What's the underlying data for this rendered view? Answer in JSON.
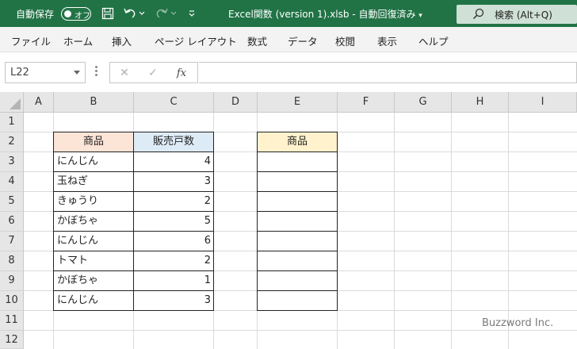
{
  "titlebar": {
    "autosave_label": "自動保存",
    "toggle_state": "オフ",
    "filename": "Excel関数 (version 1).xlsb  -  自動回復済み",
    "search_placeholder": "検索 (Alt+Q)",
    "background": "#217346"
  },
  "ribbon": {
    "tabs": [
      "ファイル",
      "ホーム",
      "挿入",
      "ページ レイアウト",
      "数式",
      "データ",
      "校閲",
      "表示",
      "ヘルプ"
    ]
  },
  "formula_bar": {
    "name_box": "L22",
    "cancel_icon": "✕",
    "enter_icon": "✓",
    "fx_label": "fx",
    "content": ""
  },
  "sheet": {
    "columns": [
      "A",
      "B",
      "C",
      "D",
      "E",
      "F",
      "G",
      "H",
      "I"
    ],
    "rows": [
      "1",
      "2",
      "3",
      "4",
      "5",
      "6",
      "7",
      "8",
      "9",
      "10",
      "11",
      "12"
    ],
    "table1": {
      "header_product": "商品",
      "header_sales": "販売戸数",
      "header_product_color": "#fce4d6",
      "header_sales_color": "#ddebf7",
      "items": [
        {
          "product": "にんじん",
          "qty": "4"
        },
        {
          "product": "玉ねぎ",
          "qty": "3"
        },
        {
          "product": "きゅうり",
          "qty": "2"
        },
        {
          "product": "かぼちゃ",
          "qty": "5"
        },
        {
          "product": "にんじん",
          "qty": "6"
        },
        {
          "product": "トマト",
          "qty": "2"
        },
        {
          "product": "かぼちゃ",
          "qty": "1"
        },
        {
          "product": "にんじん",
          "qty": "3"
        }
      ]
    },
    "table2": {
      "header": "商品",
      "header_color": "#fff2cc"
    }
  },
  "watermark": "Buzzword Inc."
}
